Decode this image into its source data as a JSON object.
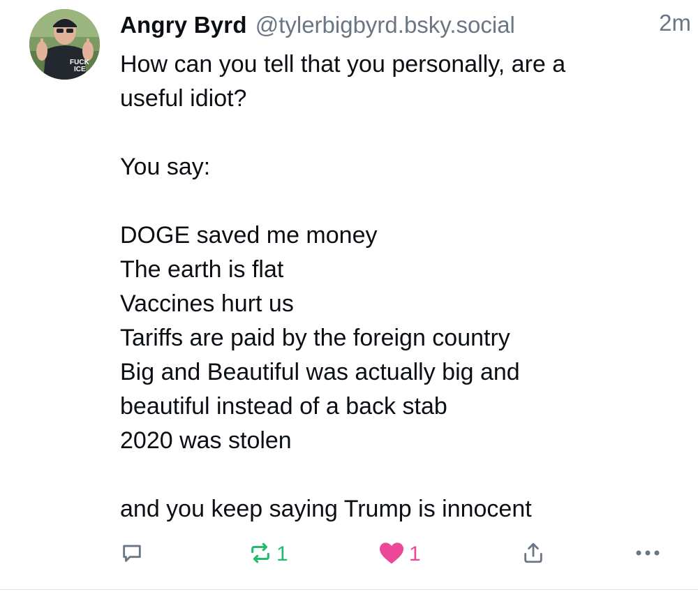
{
  "post": {
    "author": {
      "display_name": "Angry Byrd",
      "handle": "@tylerbigbyrd.bsky.social",
      "avatar_shirt_text": "FUCK ICE"
    },
    "timestamp": "2m",
    "body_lines": [
      "How can you tell that you personally, are a",
      "useful idiot?",
      "",
      "You say:",
      "",
      "DOGE saved me money",
      "The earth is flat",
      "Vaccines hurt us",
      "Tariffs are paid by the foreign country",
      "Big and Beautiful was actually big and",
      "beautiful instead of a back stab",
      "2020 was stolen",
      "",
      "and you keep saying Trump is innocent"
    ],
    "actions": {
      "reply": {
        "icon": "reply-icon"
      },
      "repost": {
        "icon": "repost-icon",
        "count": "1",
        "color": "#20bc6c"
      },
      "like": {
        "icon": "heart-icon",
        "count": "1",
        "color": "#ec4899",
        "liked": true
      },
      "share": {
        "icon": "share-icon"
      },
      "more": {
        "icon": "more-icon"
      }
    }
  },
  "colors": {
    "text_primary": "#0b0f14",
    "text_secondary": "#6b7684",
    "repost": "#20bc6c",
    "like": "#ec4899"
  }
}
